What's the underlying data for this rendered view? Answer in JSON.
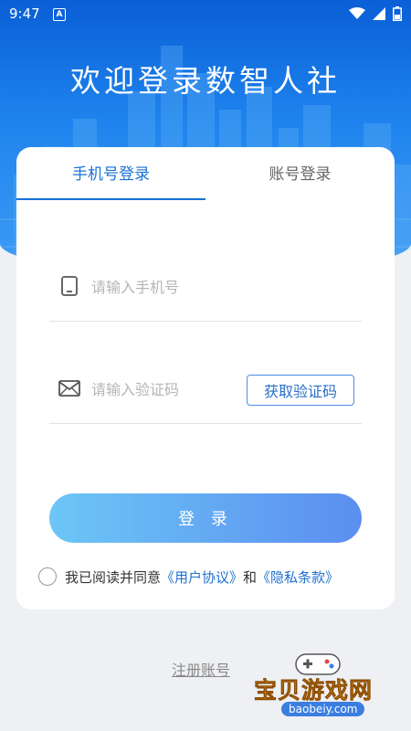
{
  "status_bar": {
    "time": "9:47",
    "app_indicator": "A"
  },
  "header": {
    "title": "欢迎登录数智人社"
  },
  "tabs": [
    {
      "label": "手机号登录",
      "active": true
    },
    {
      "label": "账号登录",
      "active": false
    }
  ],
  "form": {
    "phone_placeholder": "请输入手机号",
    "code_placeholder": "请输入验证码",
    "get_code_label": "获取验证码",
    "login_label": "登 录"
  },
  "agreement": {
    "prefix": "我已阅读并同意",
    "user_agreement": "《用户协议》",
    "conjunction": "和",
    "privacy_policy": "《隐私条款》",
    "checked": false
  },
  "register_label": "注册账号",
  "watermark": {
    "title": "宝贝游戏网",
    "url": "baobeiy.com"
  },
  "colors": {
    "primary": "#1672d6",
    "hero_top": "#0a5fd6",
    "button_start": "#6cc6f6",
    "button_end": "#5b8ef0"
  }
}
